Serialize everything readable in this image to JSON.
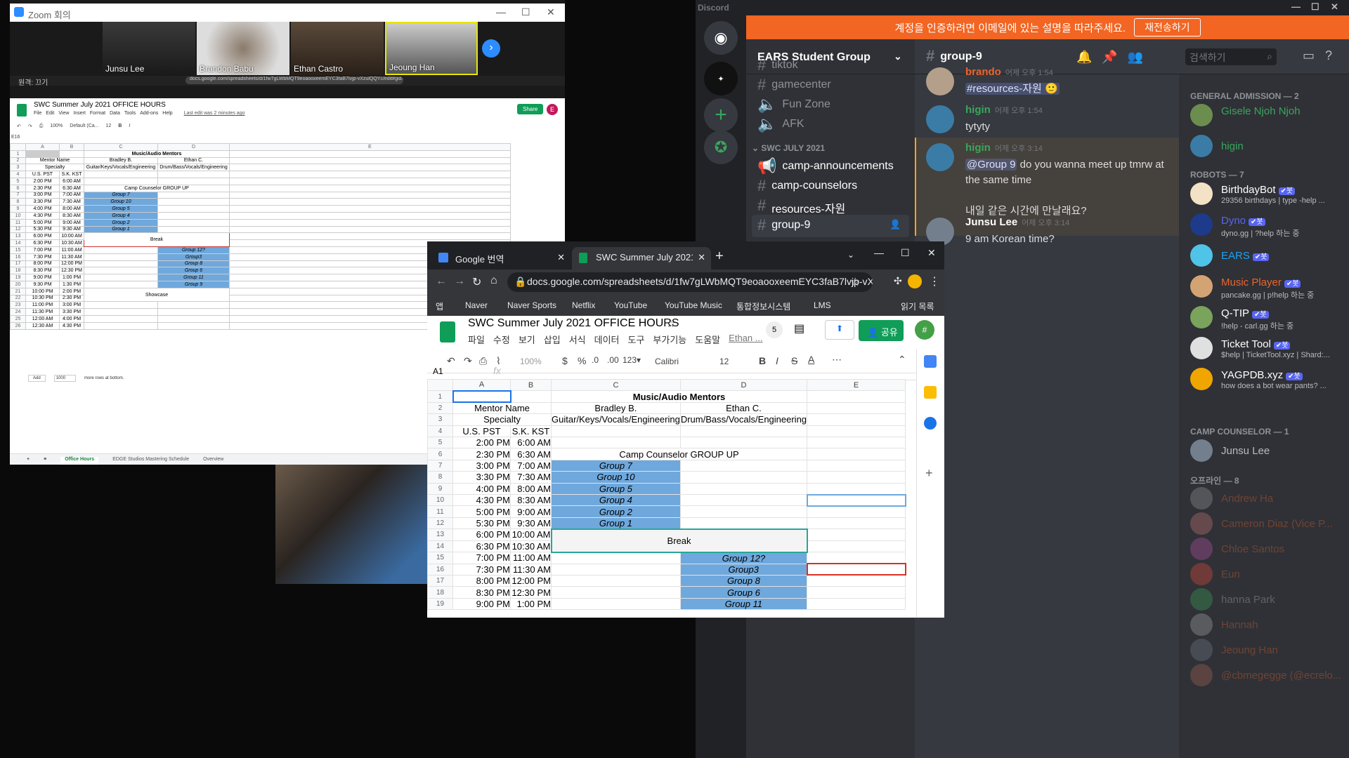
{
  "zoom": {
    "window_title": "Zoom 회의",
    "participants": [
      {
        "name": "Junsu Lee"
      },
      {
        "name": "Brandon Babu"
      },
      {
        "name": "Ethan Castro"
      },
      {
        "name": "Jeoung Han"
      }
    ],
    "remote_label": "원격: 끄기"
  },
  "small_sheet": {
    "title": "SWC Summer July 2021 OFFICE HOURS",
    "menus": [
      "File",
      "Edit",
      "View",
      "Insert",
      "Format",
      "Data",
      "Tools",
      "Add-ons",
      "Help"
    ],
    "last_edit": "Last edit was 2 minutes ago",
    "share": "Share",
    "avatar_letter": "E",
    "cell_ref": "E16",
    "zoom": "100%",
    "font": "Default (Ca...",
    "font_size": "12",
    "url": "docs.google.com/spreadsheets/d/1fw7gLWbMQT9eoaooxeemEYC3faB7lvjp-vXzulQQYc/edit#gid=12",
    "add_btn": "Add",
    "add_rows": "1000",
    "add_text": "more rows at bottom.",
    "sheet_tabs": [
      "Office Hours",
      "EDGE Studios Mastering Schedule",
      "Overview"
    ]
  },
  "discord": {
    "app_title": "Discord",
    "banner_text": "계정을 인증하려면 이메일에 있는 설명을 따라주세요.",
    "banner_button": "재전송하기",
    "guild_name": "EARS Student Group",
    "channels": [
      {
        "name": "tiktok"
      },
      {
        "name": "gamecenter"
      },
      {
        "name": "Fun Zone"
      },
      {
        "name": "AFK"
      }
    ],
    "category": "SWC JULY 2021",
    "category_channels": [
      {
        "name": "camp-announcements"
      },
      {
        "name": "camp-counselors"
      },
      {
        "name": "resources-자원"
      },
      {
        "name": "group-9"
      }
    ],
    "current_channel": "group-9",
    "search_placeholder": "검색하기",
    "messages": [
      {
        "author": "brando",
        "time": "어제 오후 1:54",
        "text": "#resources-자원 🙂",
        "color": "#e9652f"
      },
      {
        "author": "higin",
        "time": "어제 오후 1:54",
        "text": "tytyty",
        "color": "#3ba55d"
      },
      {
        "author": "higin",
        "time": "어제 오후 3:14",
        "mention": "@Group 9",
        "text": " do you wanna meet up tmrw at the same time",
        "text2": "내일 같은 시간에 만날래요?",
        "color": "#3ba55d"
      },
      {
        "author": "Junsu Lee",
        "time": "어제 오후 3:14",
        "text": "9 am Korean time?",
        "color": "#ffffff"
      }
    ],
    "members": {
      "general_header": "GENERAL ADMISSION — 2",
      "general": [
        {
          "name": "Gisele Njoh Njoh",
          "color": "#3ba55d"
        },
        {
          "name": "higin",
          "color": "#3ba55d"
        }
      ],
      "robots_header": "ROBOTS — 7",
      "robots": [
        {
          "name": "BirthdayBot",
          "sub": "29356 birthdays | type -help ...",
          "color": "#ffffff"
        },
        {
          "name": "Dyno",
          "sub": "dyno.gg | ?help 하는 중",
          "color": "#5865f2"
        },
        {
          "name": "EARS",
          "sub": "",
          "color": "#1da1f2"
        },
        {
          "name": "Music Player",
          "sub": "pancake.gg | p!help 하는 중",
          "color": "#e9652f"
        },
        {
          "name": "Q-TIP",
          "sub": "!help - carl.gg 하는 중",
          "color": "#ffffff"
        },
        {
          "name": "Ticket Tool",
          "sub": "$help | TicketTool.xyz | Shard:...",
          "color": "#ffffff"
        },
        {
          "name": "YAGPDB.xyz",
          "sub": "how does a bot wear pants? ...",
          "color": "#ffffff"
        }
      ],
      "counselor_header": "CAMP COUNSELOR — 1",
      "counselors": [
        {
          "name": "Junsu Lee",
          "color": "#b9bbbe"
        }
      ],
      "offline_header": "오프라인 — 8",
      "offline": [
        {
          "name": "Andrew Ha",
          "color": "#e9652f"
        },
        {
          "name": "Cameron Diaz (Vice P...",
          "color": "#e9652f"
        },
        {
          "name": "Chloe Santos",
          "color": "#e9652f"
        },
        {
          "name": "Eun",
          "color": "#e9652f"
        },
        {
          "name": "hanna Park",
          "color": "#b9bbbe"
        },
        {
          "name": "Hannah",
          "color": "#e9652f"
        },
        {
          "name": "Jeoung Han",
          "color": "#e9652f"
        },
        {
          "name": "@cbmegegge (@ecrelo...",
          "color": "#e9652f"
        }
      ],
      "bot_badge": "✔봇"
    }
  },
  "chrome": {
    "tabs": [
      {
        "title": "Google 번역"
      },
      {
        "title": "SWC Summer July 2021 OFFICE"
      }
    ],
    "url": "docs.google.com/spreadsheets/d/1fw7gLWbMQT9eoaooxeemEYC3faB7lvjp-vXzulQ...",
    "bookmarks": [
      "앱",
      "Naver",
      "Naver Sports",
      "Netflix",
      "YouTube",
      "YouTube Music",
      "통합정보시스템",
      "LMS",
      "읽기 목록"
    ],
    "doc_title": "SWC Summer July 2021 OFFICE HOURS",
    "menus": [
      "파일",
      "수정",
      "보기",
      "삽입",
      "서식",
      "데이터",
      "도구",
      "부가기능",
      "도움말",
      "Ethan ..."
    ],
    "viewers": "5",
    "share": "공유",
    "zoom": "100%",
    "font": "Calibri",
    "font_size": "12",
    "cell_ref": "A1",
    "fx": "fx"
  },
  "sheet": {
    "col_headers": [
      "A",
      "B",
      "C",
      "D",
      "E"
    ],
    "header_title": "Music/Audio Mentors",
    "mentor_name": "Mentor Name",
    "bradley": "Bradley B.",
    "ethan": "Ethan C.",
    "specialty": "Specialty",
    "spec_c": "Guitar/Keys/Vocals/Engineering",
    "spec_d": "Drum/Bass/Vocals/Engineering",
    "us_pst": "U.S. PST",
    "sk_kst": "S.K. KST",
    "camp_group": "Camp Counselor GROUP UP",
    "break": "Break",
    "showcase": "Showcase",
    "times_a": [
      "2:00 PM",
      "2:30 PM",
      "3:00 PM",
      "3:30 PM",
      "4:00 PM",
      "4:30 PM",
      "5:00 PM",
      "5:30 PM",
      "6:00 PM",
      "6:30 PM",
      "7:00 PM",
      "7:30 PM",
      "8:00 PM",
      "8:30 PM",
      "9:00 PM",
      "9:30 PM",
      "10:00 PM",
      "10:30 PM",
      "11:00 PM",
      "11:30 PM",
      "12:00 AM",
      "12:30 AM"
    ],
    "times_b": [
      "6:00 AM",
      "6:30 AM",
      "7:00 AM",
      "7:30 AM",
      "8:00 AM",
      "8:30 AM",
      "9:00 AM",
      "9:30 AM",
      "10:00 AM",
      "10:30 AM",
      "11:00 AM",
      "11:30 AM",
      "12:00 PM",
      "12:30 PM",
      "1:00 PM",
      "1:30 PM",
      "2:00 PM",
      "2:30 PM",
      "3:00 PM",
      "3:30 PM",
      "4:00 PM",
      "4:30 PM"
    ],
    "groups_c": [
      "Group 7",
      "Group 10",
      "Group 5",
      "Group 4",
      "Group 2",
      "Group 1"
    ],
    "groups_d": [
      "Group 12?",
      "Group3",
      "Group 8",
      "Group 6",
      "Group 11",
      "Group 9"
    ]
  }
}
